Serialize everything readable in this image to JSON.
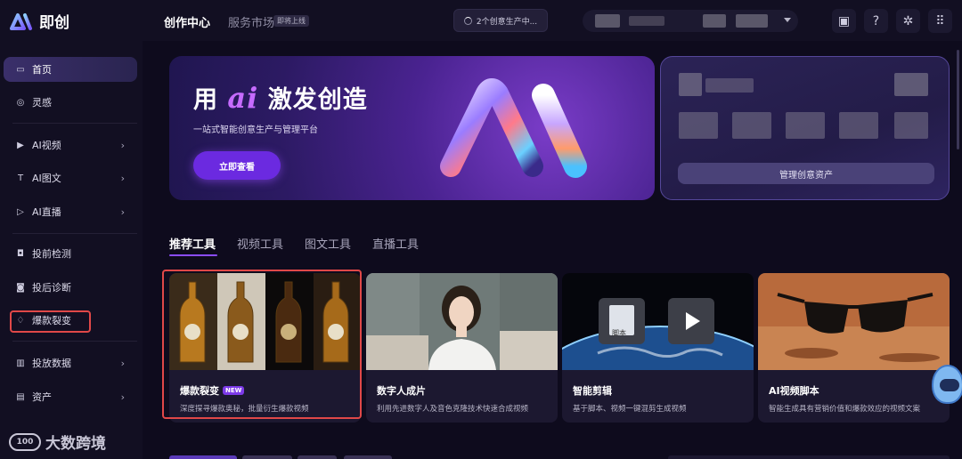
{
  "app": {
    "name": "即创"
  },
  "topbar": {
    "nav_main": "创作中心",
    "nav_market": "服务市场",
    "nav_market_badge": "即将上线",
    "generation_status": "2个创意生产中...",
    "icons": [
      "wallet-icon",
      "help-icon",
      "puzzle-icon",
      "grid-apps-icon"
    ]
  },
  "sidebar": {
    "items": [
      {
        "label": "首页",
        "icon": "home-icon",
        "active": true,
        "chevron": false
      },
      {
        "label": "灵感",
        "icon": "bulb-icon",
        "active": false,
        "chevron": false
      },
      {
        "label": "AI视频",
        "icon": "video-icon",
        "active": false,
        "chevron": true
      },
      {
        "label": "AI图文",
        "icon": "text-image-icon",
        "active": false,
        "chevron": true
      },
      {
        "label": "AI直播",
        "icon": "live-icon",
        "active": false,
        "chevron": true
      },
      {
        "label": "投前检测",
        "icon": "precheck-icon",
        "active": false,
        "chevron": false
      },
      {
        "label": "投后诊断",
        "icon": "diagnosis-icon",
        "active": false,
        "chevron": false
      },
      {
        "label": "爆款裂变",
        "icon": "fission-icon",
        "active": false,
        "chevron": false
      },
      {
        "label": "投放数据",
        "icon": "data-icon",
        "active": false,
        "chevron": true
      },
      {
        "label": "资产",
        "icon": "folder-icon",
        "active": false,
        "chevron": true
      }
    ],
    "watermark": "大数跨境"
  },
  "hero": {
    "title_prefix": "用",
    "title_ai": "ai",
    "title_suffix": "激发创造",
    "subtitle": "一站式智能创意生产与管理平台",
    "button": "立即查看"
  },
  "asset_card": {
    "button": "管理创意资产"
  },
  "tabs": [
    "推荐工具",
    "视频工具",
    "图文工具",
    "直播工具"
  ],
  "cards": [
    {
      "title": "爆款裂变",
      "badge": "NEW",
      "desc": "深度探寻爆款奥秘，批量衍生爆款视频"
    },
    {
      "title": "数字人成片",
      "badge": "",
      "desc": "利用先进数字人及音色克隆技术快速合成视频"
    },
    {
      "title": "智能剪辑",
      "badge": "",
      "desc": "基于脚本、视频一键混剪生成视频",
      "doc_label": "脚本"
    },
    {
      "title": "AI视频脚本",
      "badge": "",
      "desc": "智能生成具有营销价值和爆款效应的视频文案"
    }
  ],
  "colors": {
    "accent": "#8b4dff",
    "highlight_box": "#e04848",
    "background": "#0e0b1d"
  }
}
